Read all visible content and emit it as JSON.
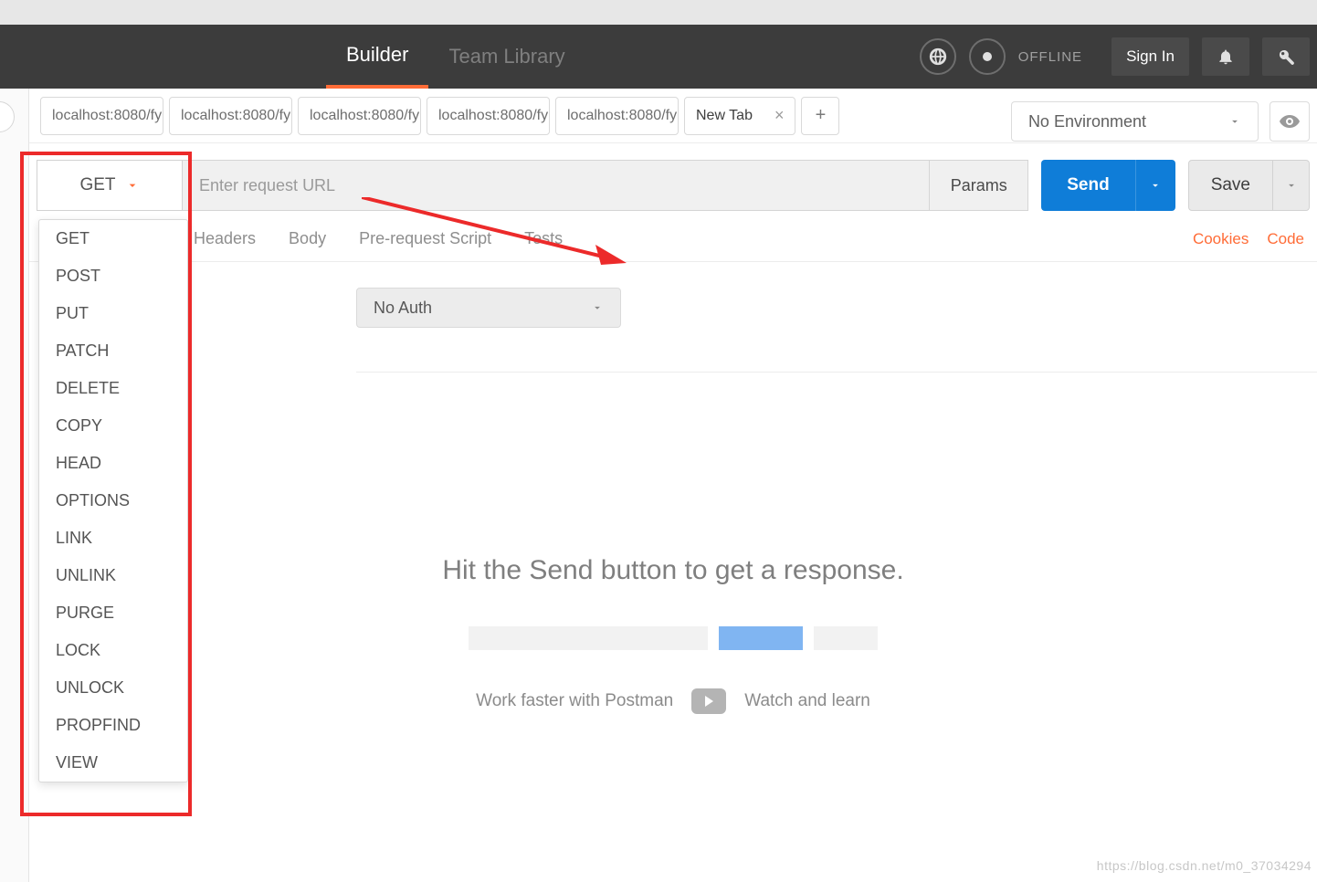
{
  "header": {
    "nav": {
      "builder": "Builder",
      "team_library": "Team Library"
    },
    "offline": "OFFLINE",
    "sign_in": "Sign In"
  },
  "tabs": {
    "items": [
      {
        "label": "localhost:8080/fy"
      },
      {
        "label": "localhost:8080/fy"
      },
      {
        "label": "localhost:8080/fy"
      },
      {
        "label": "localhost:8080/fy"
      },
      {
        "label": "localhost:8080/fy"
      }
    ],
    "new_tab": "New Tab"
  },
  "env": {
    "label": "No Environment"
  },
  "request": {
    "method": "GET",
    "url_placeholder": "Enter request URL",
    "params": "Params",
    "send": "Send",
    "save": "Save",
    "methods": [
      "GET",
      "POST",
      "PUT",
      "PATCH",
      "DELETE",
      "COPY",
      "HEAD",
      "OPTIONS",
      "LINK",
      "UNLINK",
      "PURGE",
      "LOCK",
      "UNLOCK",
      "PROPFIND",
      "VIEW"
    ]
  },
  "subtabs": {
    "headers": "Headers",
    "body": "Body",
    "prerequest": "Pre-request Script",
    "tests": "Tests",
    "cookies": "Cookies",
    "code": "Code"
  },
  "auth": {
    "type": "No Auth"
  },
  "empty": {
    "title": "Hit the Send button to get a response.",
    "learn_left": "Work faster with Postman",
    "learn_right": "Watch and learn"
  },
  "watermark": "https://blog.csdn.net/m0_37034294"
}
